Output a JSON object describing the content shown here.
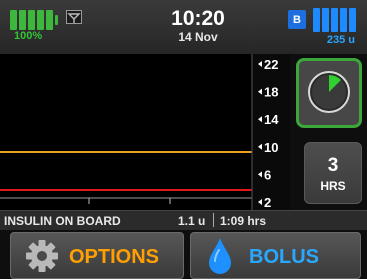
{
  "status_bar": {
    "battery_percent": "100%",
    "battery_level": 1.0,
    "time": "10:20",
    "date": "14 Nov",
    "bluetooth_label": "B",
    "reservoir_units": "235 u",
    "icons": [
      "battery-icon",
      "signal-icon",
      "bluetooth-icon",
      "reservoir-icon"
    ]
  },
  "chart": {
    "scale_labels": [
      "22",
      "18",
      "14",
      "10",
      "6",
      "2"
    ],
    "upper_target_line": 10,
    "lower_target_line": 4,
    "colors": {
      "upper_line": "#e8a020",
      "lower_line": "#e01818",
      "background": "#000000"
    }
  },
  "controls": {
    "hours_value": "3",
    "hours_unit": "HRS",
    "dial_icon": "dial-icon",
    "accent": "#3da83a"
  },
  "iob": {
    "label": "INSULIN ON BOARD",
    "units": "1.1 u",
    "time": "1:09 hrs"
  },
  "buttons": {
    "options": {
      "label": "OPTIONS",
      "icon": "gear-icon",
      "color": "#ffa000"
    },
    "bolus": {
      "label": "BOLUS",
      "icon": "droplet-icon",
      "color": "#29a8ff"
    }
  }
}
